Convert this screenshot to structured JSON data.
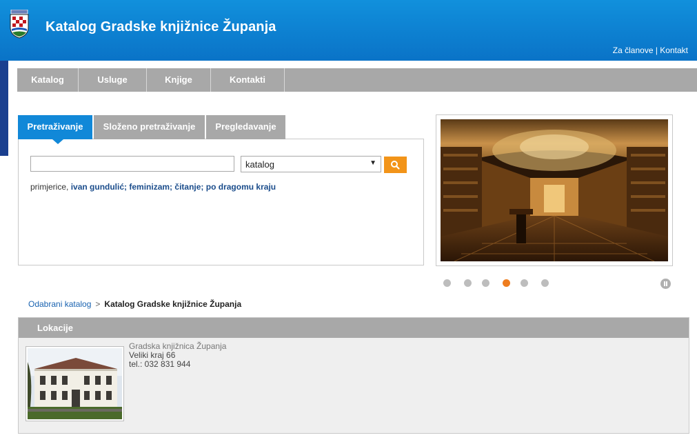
{
  "header": {
    "title": "Katalog Gradske knjižnice Županja",
    "links": {
      "members": "Za članove",
      "separator": " | ",
      "contact": "Kontakt"
    }
  },
  "nav": {
    "items": [
      {
        "label": "Katalog"
      },
      {
        "label": "Usluge"
      },
      {
        "label": "Knjige"
      },
      {
        "label": "Kontakti"
      }
    ]
  },
  "search": {
    "tabs": [
      {
        "label": "Pretraživanje",
        "active": true
      },
      {
        "label": "Složeno pretraživanje",
        "active": false
      },
      {
        "label": "Pregledavanje",
        "active": false
      }
    ],
    "input_value": "",
    "select_value": "katalog",
    "examples_prefix": "primjerice, ",
    "examples": [
      "ivan gundulić;",
      "feminizam;",
      "čitanje;",
      "po dragomu kraju"
    ]
  },
  "slider": {
    "dot_count": 6,
    "active_dot": 4
  },
  "breadcrumb": {
    "parent": "Odabrani katalog",
    "separator": ">",
    "current": "Katalog Gradske knjižnice Županja"
  },
  "locations": {
    "title": "Lokacije",
    "item": {
      "name": "Gradska knjižnica Županja",
      "address": "Veliki kraj 66",
      "phone": "tel.: 032 831 944"
    }
  },
  "colors": {
    "header_blue": "#0a73c7",
    "accent_orange": "#f29419",
    "nav_gray": "#a8a8a8",
    "tab_active": "#1188d8"
  }
}
